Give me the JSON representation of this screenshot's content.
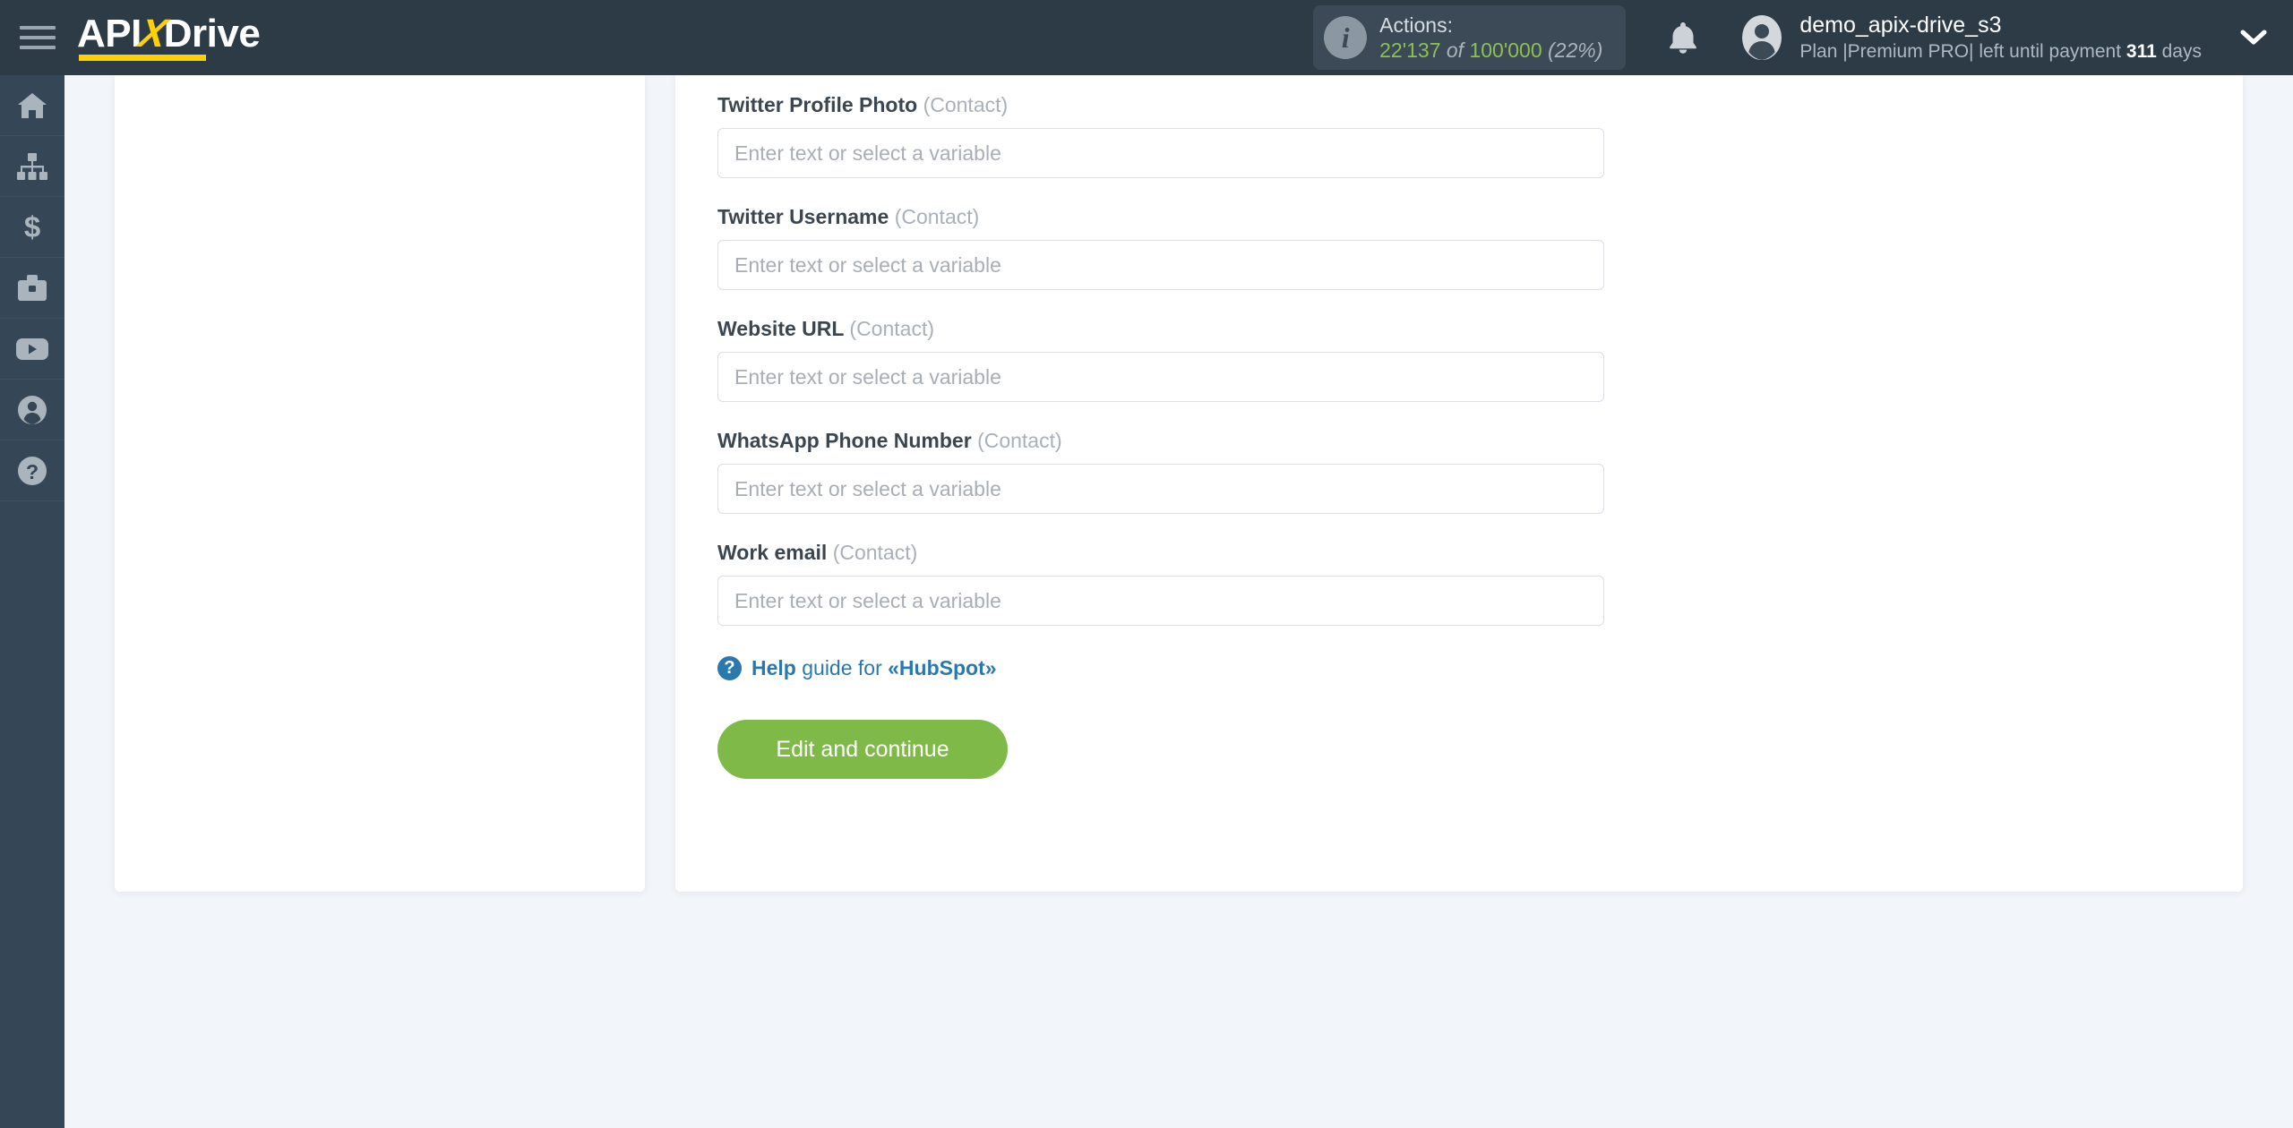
{
  "header": {
    "menu_icon": "hamburger-icon",
    "logo": {
      "part1": "API",
      "part2": "X",
      "part3": "Drive"
    },
    "actions": {
      "icon": "info-icon",
      "title": "Actions:",
      "used": "22'137",
      "of": "of",
      "total": "100'000",
      "percent": "(22%)"
    },
    "notifications_icon": "bell-icon",
    "account": {
      "avatar_icon": "user-avatar-icon",
      "username": "demo_apix-drive_s3",
      "plan_prefix": "Plan |Premium PRO| left until payment ",
      "plan_days": "311",
      "plan_suffix": " days"
    },
    "dropdown_icon": "chevron-down-icon"
  },
  "sidebar": {
    "items": [
      {
        "name": "home",
        "icon": "home-icon"
      },
      {
        "name": "connections",
        "icon": "sitemap-icon"
      },
      {
        "name": "pricing",
        "icon": "dollar-icon"
      },
      {
        "name": "business",
        "icon": "briefcase-icon"
      },
      {
        "name": "video",
        "icon": "youtube-icon"
      },
      {
        "name": "profile",
        "icon": "user-circle-icon"
      },
      {
        "name": "help",
        "icon": "question-circle-icon"
      }
    ]
  },
  "form": {
    "placeholder": "Enter text or select a variable",
    "entity_suffix": "(Contact)",
    "fields": [
      {
        "label": "Twitter Profile Photo",
        "entity": "(Contact)",
        "value": ""
      },
      {
        "label": "Twitter Username",
        "entity": "(Contact)",
        "value": ""
      },
      {
        "label": "Website URL",
        "entity": "(Contact)",
        "value": ""
      },
      {
        "label": "WhatsApp Phone Number",
        "entity": "(Contact)",
        "value": ""
      },
      {
        "label": "Work email",
        "entity": "(Contact)",
        "value": ""
      }
    ],
    "help": {
      "icon": "question-mark-icon",
      "strong": "Help",
      "middle": " guide for ",
      "target": "«HubSpot»"
    },
    "submit_label": "Edit and continue"
  },
  "colors": {
    "topbar": "#2d3b47",
    "sidebar": "#354656",
    "accent_yellow": "#ffd100",
    "accent_green": "#7fb948",
    "link_blue": "#2a78ad",
    "page_bg": "#f2f5f9",
    "counter_green": "#8cc152"
  }
}
